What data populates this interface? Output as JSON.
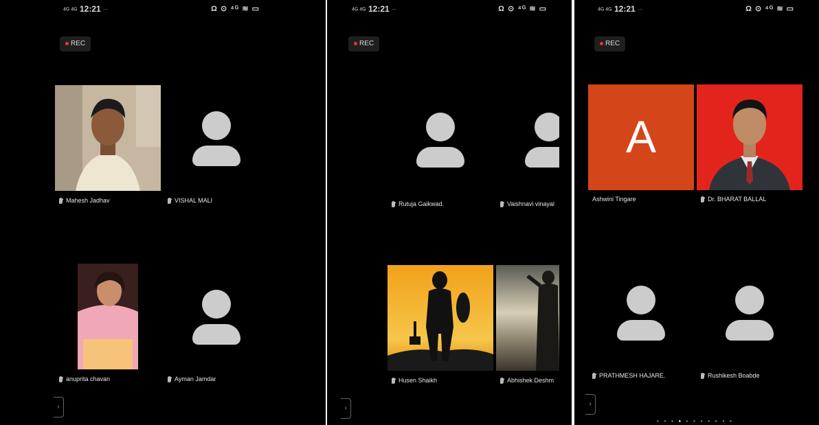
{
  "status_bar": {
    "time": "12:21",
    "net_left": "4G 4G",
    "right": "Ω ⊙ ⁴ᴳ ≋ ▭",
    "ellipsis": "···"
  },
  "rec_label": "REC",
  "side_button": "›",
  "colors": {
    "background": "#000000",
    "avatar_placeholder": "#cccccc",
    "rec_dot": "#e53935",
    "tile_ashwini": "#d44619",
    "tile_bharat": "#e3241d"
  },
  "panels": [
    {
      "participants": [
        {
          "name": "Mahesh Jadhav",
          "tile": "photo"
        },
        {
          "name": "VISHAL MALI",
          "tile": "avatar"
        },
        {
          "name": "anuprita chavan",
          "tile": "photo"
        },
        {
          "name": "Ayman Jamdar",
          "tile": "avatar"
        }
      ]
    },
    {
      "participants": [
        {
          "name": "Rutuja Gaikwad.",
          "tile": "avatar"
        },
        {
          "name": "Vaishnavi vinayal",
          "tile": "avatar"
        },
        {
          "name": "Husen Shaikh",
          "tile": "photo"
        },
        {
          "name": "Abhishek Deshm",
          "tile": "photo"
        }
      ]
    },
    {
      "participants": [
        {
          "name": "Ashwini Tingare",
          "tile": "initial",
          "initial": "A"
        },
        {
          "name": "Dr. BHARAT BALLAL",
          "tile": "photo"
        },
        {
          "name": "PRATHMESH HAJARE.",
          "tile": "avatar"
        },
        {
          "name": "Rushikesh Boabde",
          "tile": "avatar"
        }
      ]
    }
  ]
}
